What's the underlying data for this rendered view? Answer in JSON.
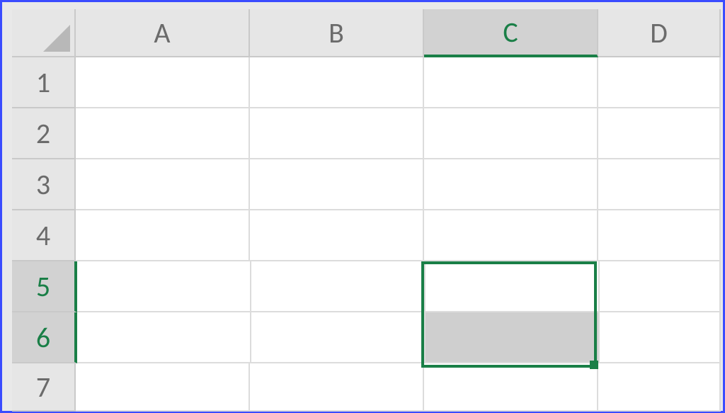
{
  "columns": [
    "A",
    "B",
    "C",
    "D"
  ],
  "rows": [
    "1",
    "2",
    "3",
    "4",
    "5",
    "6",
    "7"
  ],
  "selected_column_index": 2,
  "selected_row_indices": [
    4,
    5
  ],
  "selection_range": "C5:C6",
  "active_cell": "C5",
  "shaded_cells": [
    "C6"
  ],
  "cell_values": {}
}
